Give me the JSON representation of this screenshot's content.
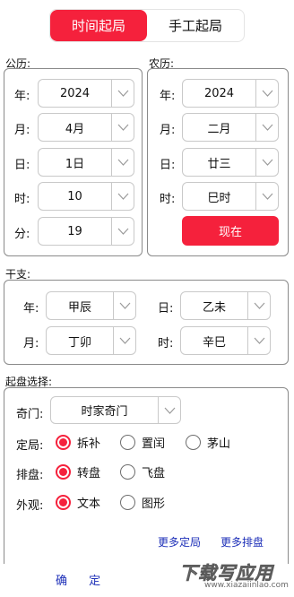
{
  "mode_tabs": [
    {
      "label": "时间起局",
      "active": true
    },
    {
      "label": "手工起局",
      "active": false
    }
  ],
  "gregorian": {
    "title": "公历:",
    "rows": [
      {
        "label": "年:",
        "value": "2024"
      },
      {
        "label": "月:",
        "value": "4月"
      },
      {
        "label": "日:",
        "value": "1日"
      },
      {
        "label": "时:",
        "value": "10"
      },
      {
        "label": "分:",
        "value": "19"
      }
    ]
  },
  "lunar": {
    "title": "农历:",
    "rows": [
      {
        "label": "年:",
        "value": "2024"
      },
      {
        "label": "月:",
        "value": "二月"
      },
      {
        "label": "日:",
        "value": "廿三"
      },
      {
        "label": "时:",
        "value": "巳时"
      }
    ],
    "now_button": "现在"
  },
  "ganzhi": {
    "title": "干支:",
    "year": {
      "label": "年:",
      "value": "甲辰"
    },
    "day": {
      "label": "日:",
      "value": "乙未"
    },
    "month": {
      "label": "月:",
      "value": "丁卯"
    },
    "hour": {
      "label": "时:",
      "value": "辛巳"
    }
  },
  "chart_setup": {
    "title": "起盘选择:",
    "qimen": {
      "label": "奇门:",
      "value": "时家奇门"
    },
    "dingju": {
      "label": "定局:",
      "options": [
        "拆补",
        "置闰",
        "茅山"
      ],
      "selected": 0
    },
    "paipan": {
      "label": "排盘:",
      "options": [
        "转盘",
        "飞盘"
      ],
      "selected": 0
    },
    "waiguan": {
      "label": "外观:",
      "options": [
        "文本",
        "图形"
      ],
      "selected": 0
    },
    "links": [
      "更多定局",
      "更多排盘"
    ]
  },
  "footer": {
    "confirm": "确 定"
  },
  "watermark": {
    "main": "下载写应用",
    "sub": "www.xiazaiinlao.com"
  },
  "colors": {
    "accent": "#f5213c",
    "link": "#1d2fb8",
    "border": "#8a8a8a"
  }
}
